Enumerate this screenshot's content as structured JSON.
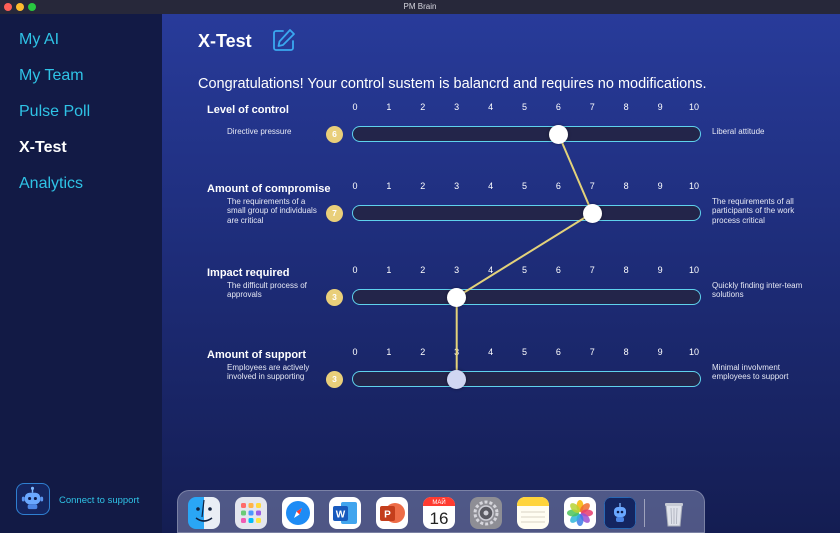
{
  "window": {
    "title": "PM Brain"
  },
  "sidebar": {
    "items": [
      {
        "label": "My AI",
        "active": false
      },
      {
        "label": "My Team",
        "active": false
      },
      {
        "label": "Pulse Poll",
        "active": false
      },
      {
        "label": "X-Test",
        "active": true
      },
      {
        "label": "Analytics",
        "active": false
      }
    ],
    "support_label": "Connect to support",
    "support_icon": "robot-icon"
  },
  "main": {
    "title": "X-Test",
    "edit_icon": "edit-icon",
    "message": "Congratulations! Your control sustem is balancrd and requires no modifications.",
    "scale_min": 0,
    "scale_max": 10,
    "sections": [
      {
        "title": "Level of control",
        "ticks": [
          "0",
          "1",
          "2",
          "3",
          "4",
          "5",
          "6",
          "7",
          "8",
          "9",
          "10"
        ],
        "left_label": "Directive pressure",
        "right_label": "Liberal attitude",
        "value": 6,
        "value_label": "6"
      },
      {
        "title": "Amount of compromise",
        "ticks": [
          "0",
          "1",
          "2",
          "3",
          "4",
          "5",
          "6",
          "7",
          "8",
          "9",
          "10"
        ],
        "left_label": "The requirements of a small group of individuals are critical",
        "right_label": "The requirements of all participants of the work process critical",
        "value": 7,
        "value_label": "7"
      },
      {
        "title": "Impact required",
        "ticks": [
          "0",
          "1",
          "2",
          "3",
          "4",
          "5",
          "6",
          "7",
          "8",
          "9",
          "10"
        ],
        "left_label": "The difficult process of approvals",
        "right_label": "Quickly finding inter-team solutions",
        "value": 3,
        "value_label": "3"
      },
      {
        "title": "Amount of support",
        "ticks": [
          "0",
          "1",
          "2",
          "3",
          "4",
          "5",
          "6",
          "7",
          "8",
          "9",
          "10"
        ],
        "left_label": "Employees are actively involved in supporting",
        "right_label": "Minimal involvment employees to support",
        "value": 3,
        "value_label": "3"
      }
    ]
  },
  "dock": {
    "items": [
      {
        "name": "finder-icon"
      },
      {
        "name": "launchpad-icon"
      },
      {
        "name": "safari-icon"
      },
      {
        "name": "word-icon",
        "letter": "W"
      },
      {
        "name": "powerpoint-icon",
        "letter": "P"
      },
      {
        "name": "calendar-icon",
        "month": "МАЙ",
        "day": "16"
      },
      {
        "name": "system-settings-icon"
      },
      {
        "name": "notes-icon"
      },
      {
        "name": "photos-icon"
      },
      {
        "name": "pm-brain-icon"
      },
      {
        "name": "trash-icon"
      }
    ]
  },
  "colors": {
    "accent": "#2fc3e6",
    "badge": "#e9cf7a",
    "connector": "#e3d27a",
    "track_border": "#5fd2ec"
  }
}
